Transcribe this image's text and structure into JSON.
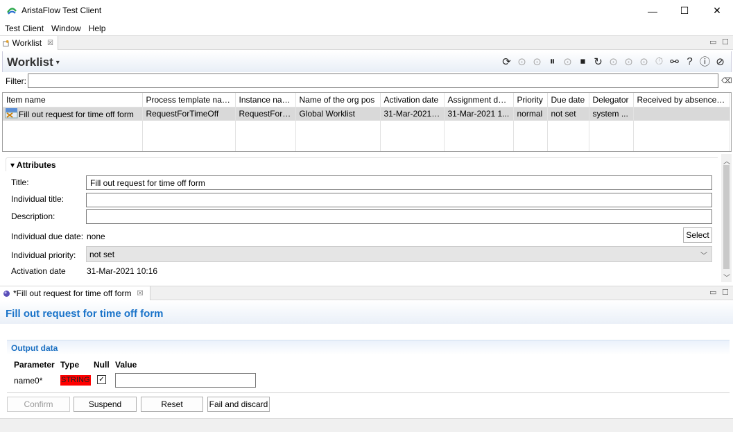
{
  "window": {
    "title": "AristaFlow Test Client",
    "min": "—",
    "max": "☐",
    "close": "✕"
  },
  "menu": [
    "Test Client",
    "Window",
    "Help"
  ],
  "worklist_tab": {
    "label": "Worklist",
    "close": "☒"
  },
  "view_ctrl": {
    "minimize": "▭",
    "maximize": "☐"
  },
  "worklist": {
    "title": "Worklist",
    "toolbar": [
      {
        "name": "refresh-icon",
        "glyph": "⟳",
        "enabled": true
      },
      {
        "name": "down-icon",
        "glyph": "⊙",
        "enabled": false
      },
      {
        "name": "start-icon",
        "glyph": "⊙",
        "enabled": false
      },
      {
        "name": "suspend-icon",
        "glyph": "⏸",
        "enabled": true
      },
      {
        "name": "check-icon",
        "glyph": "⊙",
        "enabled": false
      },
      {
        "name": "stop-icon",
        "glyph": "⏹",
        "enabled": true
      },
      {
        "name": "redo-icon",
        "glyph": "↻",
        "enabled": true
      },
      {
        "name": "forward-icon",
        "glyph": "⊙",
        "enabled": false
      },
      {
        "name": "comment-icon",
        "glyph": "⊙",
        "enabled": false
      },
      {
        "name": "delegate-icon",
        "glyph": "⊙",
        "enabled": false
      },
      {
        "name": "timer-icon",
        "glyph": "⏱",
        "enabled": false
      },
      {
        "name": "link-icon",
        "glyph": "⚯",
        "enabled": true
      },
      {
        "name": "help-icon",
        "glyph": "?",
        "enabled": true
      },
      {
        "name": "info-icon",
        "glyph": "ⓘ",
        "enabled": true
      },
      {
        "name": "cancel-icon",
        "glyph": "⊘",
        "enabled": true
      }
    ],
    "filter_label": "Filter:",
    "filter_value": "",
    "filter_clear": "⌫",
    "columns": [
      "Item name",
      "Process template name",
      "Instance name",
      "Name of the org pos",
      "Activation date",
      "Assignment date",
      "Priority",
      "Due date",
      "Delegator",
      "Received by absence of"
    ],
    "rows": [
      [
        "Fill out request for time off form",
        "RequestForTimeOff",
        "RequestForTi...",
        "Global Worklist",
        "31-Mar-2021 ...",
        "31-Mar-2021 1...",
        "normal",
        "not set",
        "system ...",
        ""
      ]
    ]
  },
  "attributes": {
    "heading": "Attributes",
    "toggle": "▾",
    "title_label": "Title:",
    "title_value": "Fill out request for time off form",
    "individual_title_label": "Individual title:",
    "individual_title_value": "",
    "description_label": "Description:",
    "description_value": "",
    "due_label": "Individual due date:",
    "due_value": "none",
    "select_button": "Select",
    "priority_label": "Individual priority:",
    "priority_value": "not set",
    "activation_label": "Activation date",
    "activation_value": "31-Mar-2021 10:16"
  },
  "form_tab": {
    "label": "*Fill out request for time off form",
    "close": "☒"
  },
  "form": {
    "title": "Fill out request for time off form",
    "section": "Output data",
    "headers": {
      "parameter": "Parameter",
      "type": "Type",
      "null": "Null",
      "value": "Value"
    },
    "param": {
      "name": "name0*",
      "type": "STRING",
      "null_check": "✓",
      "value": ""
    },
    "buttons": {
      "confirm": "Confirm",
      "suspend": "Suspend",
      "reset": "Reset",
      "fail": "Fail and discard"
    }
  }
}
